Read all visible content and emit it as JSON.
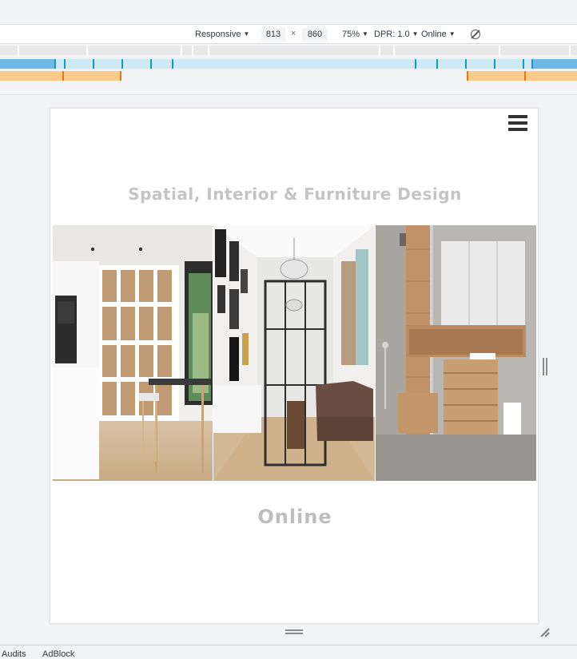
{
  "devtools": {
    "device": "Responsive",
    "width": "813",
    "times": "×",
    "height": "860",
    "zoom": "75%",
    "dpr": "DPR: 1.0",
    "network": "Online",
    "caret": "▼"
  },
  "page": {
    "headline": "Spatial, Interior & Furniture Design",
    "subline": "Online"
  },
  "bottom_tabs": [
    "Audits",
    "AdBlock"
  ],
  "colors": {
    "ruler_blue": "#6cb8e6",
    "ruler_orange": "#f9c98a",
    "headline_text": "#c4c4c4"
  }
}
